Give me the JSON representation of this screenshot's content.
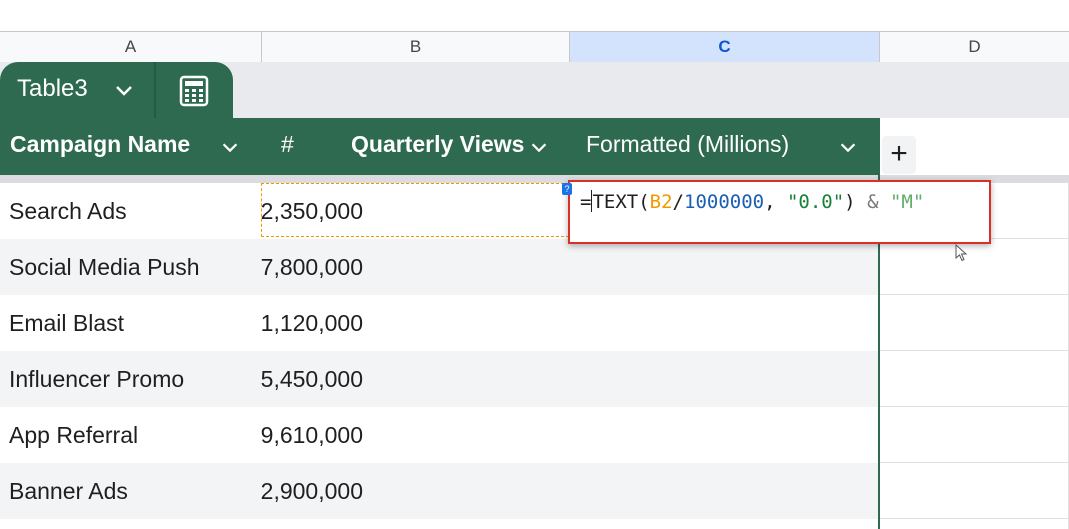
{
  "columns": [
    "A",
    "B",
    "C",
    "D"
  ],
  "selected_column": "C",
  "table": {
    "name": "Table3",
    "headers": [
      {
        "label": "Campaign Name",
        "bold": true
      },
      {
        "label": "#",
        "bold": false
      },
      {
        "label": "Quarterly Views",
        "bold": true
      },
      {
        "label": "Formatted (Millions)",
        "bold": false
      }
    ],
    "rows": [
      {
        "name": "Search Ads",
        "views": "2,350,000"
      },
      {
        "name": "Social Media Push",
        "views": "7,800,000"
      },
      {
        "name": "Email Blast",
        "views": "1,120,000"
      },
      {
        "name": "Influencer Promo",
        "views": "5,450,000"
      },
      {
        "name": "App Referral",
        "views": "9,610,000"
      },
      {
        "name": "Banner Ads",
        "views": "2,900,000"
      }
    ]
  },
  "add_column_label": "+",
  "formula": {
    "eq": "=",
    "fn": "TEXT(",
    "ref": "B2",
    "slash": "/",
    "num": "1000000",
    "comma": ", ",
    "str1": "\"0.0\"",
    "close": ")",
    "amp": " & ",
    "str2": "\"M\""
  },
  "help_badge": "?",
  "colors": {
    "table_green": "#2d6a4f",
    "ref_orange": "#f29900",
    "num_blue": "#1a5fb4",
    "string_green": "#188038",
    "editor_border": "#d93025"
  }
}
